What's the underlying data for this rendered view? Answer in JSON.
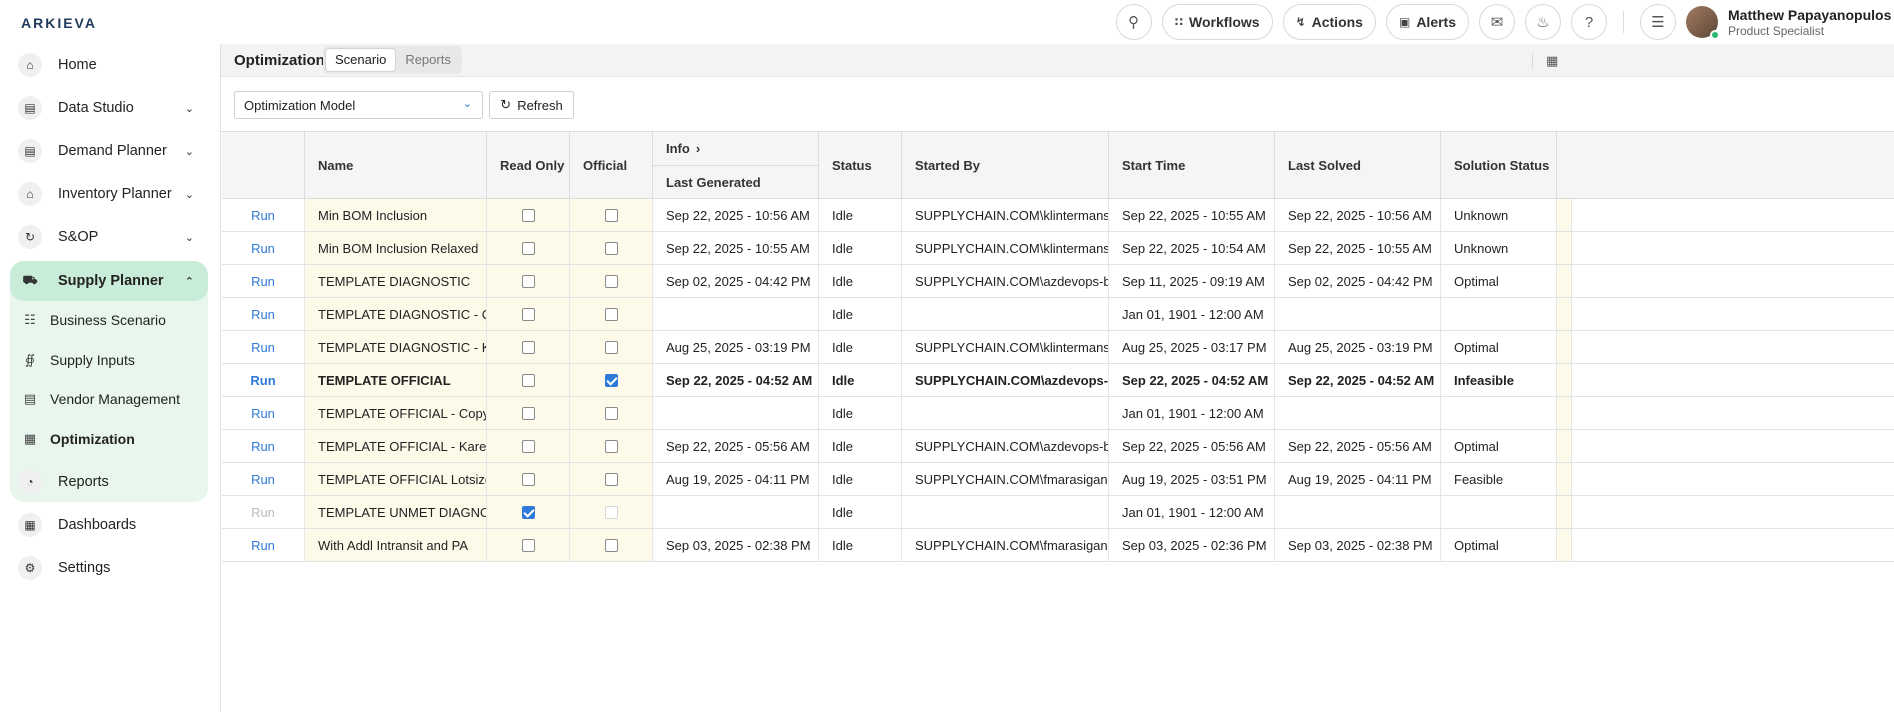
{
  "app": {
    "logo": "ARKIEVA"
  },
  "topbar": {
    "workflows": "Workflows",
    "actions": "Actions",
    "alerts": "Alerts",
    "user_name": "Matthew Papayanopulos",
    "user_role": "Product Specialist"
  },
  "sidebar": {
    "items": [
      {
        "label": "Home",
        "icon": "home-icon"
      },
      {
        "label": "Data Studio",
        "icon": "chart-icon"
      },
      {
        "label": "Demand Planner",
        "icon": "document-icon"
      },
      {
        "label": "Inventory Planner",
        "icon": "warehouse-icon"
      },
      {
        "label": "S&OP",
        "icon": "cycle-icon"
      },
      {
        "label": "Supply Planner",
        "icon": "truck-icon"
      },
      {
        "label": "Reports",
        "icon": "pie-icon"
      },
      {
        "label": "Dashboards",
        "icon": "dashboard-icon"
      },
      {
        "label": "Settings",
        "icon": "gear-icon"
      }
    ],
    "sub_items": [
      {
        "label": "Business Scenario",
        "icon": "sitemap-icon"
      },
      {
        "label": "Supply Inputs",
        "icon": "inputs-icon"
      },
      {
        "label": "Vendor Management",
        "icon": "list-icon"
      },
      {
        "label": "Optimization",
        "icon": "table-icon"
      }
    ]
  },
  "page": {
    "title": "Optimization",
    "tabs": [
      "Scenario",
      "Reports"
    ],
    "active_tab": "Scenario",
    "model_select": "Optimization Model",
    "refresh": "Refresh"
  },
  "table": {
    "headers": {
      "name": "Name",
      "read_only": "Read Only",
      "official": "Official",
      "info": "Info",
      "last_generated": "Last Generated",
      "status": "Status",
      "started_by": "Started By",
      "start_time": "Start Time",
      "last_solved": "Last Solved",
      "solution_status": "Solution Status"
    },
    "rows": [
      {
        "run": "Run",
        "name": "Min BOM Inclusion",
        "read_only": false,
        "official": false,
        "last_generated": "Sep 22, 2025 - 10:56 AM",
        "status": "Idle",
        "started_by": "SUPPLYCHAIN.COM\\klintermans",
        "start_time": "Sep 22, 2025 - 10:55 AM",
        "last_solved": "Sep 22, 2025 - 10:56 AM",
        "solution_status": "Unknown"
      },
      {
        "run": "Run",
        "name": "Min BOM Inclusion Relaxed",
        "read_only": false,
        "official": false,
        "last_generated": "Sep 22, 2025 - 10:55 AM",
        "status": "Idle",
        "started_by": "SUPPLYCHAIN.COM\\klintermans",
        "start_time": "Sep 22, 2025 - 10:54 AM",
        "last_solved": "Sep 22, 2025 - 10:55 AM",
        "solution_status": "Unknown"
      },
      {
        "run": "Run",
        "name": "TEMPLATE DIAGNOSTIC",
        "read_only": false,
        "official": false,
        "last_generated": "Sep 02, 2025 - 04:42 PM",
        "status": "Idle",
        "started_by": "SUPPLYCHAIN.COM\\azdevops-b...",
        "start_time": "Sep 11, 2025 - 09:19 AM",
        "last_solved": "Sep 02, 2025 - 04:42 PM",
        "solution_status": "Optimal"
      },
      {
        "run": "Run",
        "name": "TEMPLATE DIAGNOSTIC - C...",
        "read_only": false,
        "official": false,
        "last_generated": "",
        "status": "Idle",
        "started_by": "",
        "start_time": "Jan 01, 1901 - 12:00 AM",
        "last_solved": "",
        "solution_status": ""
      },
      {
        "run": "Run",
        "name": "TEMPLATE DIAGNOSTIC - K...",
        "read_only": false,
        "official": false,
        "last_generated": "Aug 25, 2025 - 03:19 PM",
        "status": "Idle",
        "started_by": "SUPPLYCHAIN.COM\\klintermans",
        "start_time": "Aug 25, 2025 - 03:17 PM",
        "last_solved": "Aug 25, 2025 - 03:19 PM",
        "solution_status": "Optimal"
      },
      {
        "run": "Run",
        "name": "TEMPLATE OFFICIAL",
        "read_only": false,
        "official": true,
        "bold": true,
        "last_generated": "Sep 22, 2025 - 04:52 AM",
        "status": "Idle",
        "started_by": "SUPPLYCHAIN.COM\\azdevops-b...",
        "start_time": "Sep 22, 2025 - 04:52 AM",
        "last_solved": "Sep 22, 2025 - 04:52 AM",
        "solution_status": "Infeasible"
      },
      {
        "run": "Run",
        "name": "TEMPLATE OFFICIAL - Copy ...",
        "read_only": false,
        "official": false,
        "last_generated": "",
        "status": "Idle",
        "started_by": "",
        "start_time": "Jan 01, 1901 - 12:00 AM",
        "last_solved": "",
        "solution_status": ""
      },
      {
        "run": "Run",
        "name": "TEMPLATE OFFICIAL - Karel",
        "read_only": false,
        "official": false,
        "last_generated": "Sep 22, 2025 - 05:56 AM",
        "status": "Idle",
        "started_by": "SUPPLYCHAIN.COM\\azdevops-b...",
        "start_time": "Sep 22, 2025 - 05:56 AM",
        "last_solved": "Sep 22, 2025 - 05:56 AM",
        "solution_status": "Optimal"
      },
      {
        "run": "Run",
        "name": "TEMPLATE OFFICIAL Lotsized",
        "read_only": false,
        "official": false,
        "last_generated": "Aug 19, 2025 - 04:11 PM",
        "status": "Idle",
        "started_by": "SUPPLYCHAIN.COM\\fmarasigan",
        "start_time": "Aug 19, 2025 - 03:51 PM",
        "last_solved": "Aug 19, 2025 - 04:11 PM",
        "solution_status": "Feasible"
      },
      {
        "run": "Run",
        "name": "TEMPLATE UNMET DIAGNO...",
        "read_only": true,
        "official": false,
        "disabled": true,
        "last_generated": "",
        "status": "Idle",
        "started_by": "",
        "start_time": "Jan 01, 1901 - 12:00 AM",
        "last_solved": "",
        "solution_status": ""
      },
      {
        "run": "Run",
        "name": "With Addl Intransit and PA",
        "read_only": false,
        "official": false,
        "last_generated": "Sep 03, 2025 - 02:38 PM",
        "status": "Idle",
        "started_by": "SUPPLYCHAIN.COM\\fmarasigan",
        "start_time": "Sep 03, 2025 - 02:36 PM",
        "last_solved": "Sep 03, 2025 - 02:38 PM",
        "solution_status": "Optimal"
      }
    ]
  },
  "colors": {
    "accent": "#2f7ad8",
    "nav_active": "#c9ecd8",
    "nav_group": "#e8f6ee",
    "editable_cell": "#fdfaea"
  }
}
